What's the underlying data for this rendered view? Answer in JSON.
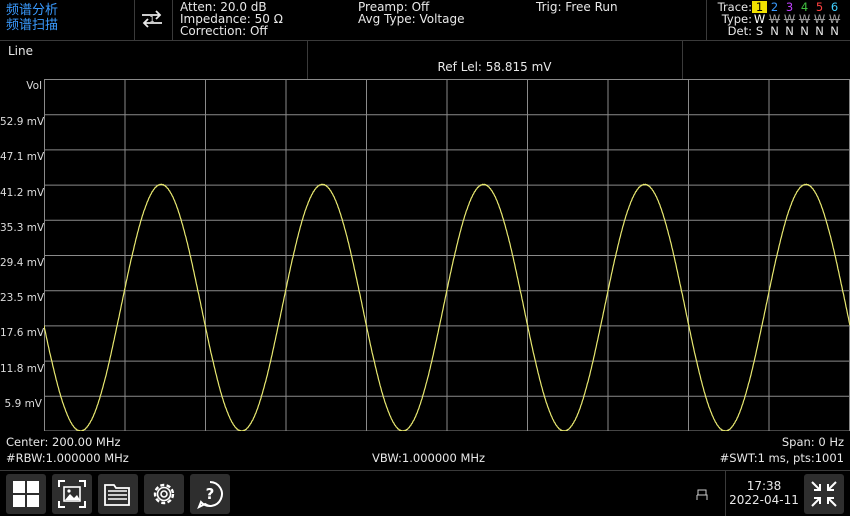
{
  "mode": {
    "line1": "频谱分析",
    "line2": "频谱扫描"
  },
  "status": {
    "atten": "Atten: 20.0 dB",
    "impedance": "Impedance: 50 Ω",
    "correction": "Correction: Off",
    "preamp": "Preamp: Off",
    "avg_type": "Avg Type: Voltage",
    "trig": "Trig: Free Run"
  },
  "trace_panel": {
    "trace_label": "Trace:",
    "type_label": "Type:",
    "det_label": "Det:",
    "numbers": [
      "1",
      "2",
      "3",
      "4",
      "5",
      "6"
    ],
    "number_colors": [
      "#000000",
      "#3a9bff",
      "#c040ff",
      "#40c040",
      "#ff4040",
      "#40d0ff"
    ],
    "types": [
      "W",
      "W",
      "W",
      "W",
      "W",
      "W"
    ],
    "dets": [
      "S",
      "N",
      "N",
      "N",
      "N",
      "N"
    ]
  },
  "header": {
    "title": "Line",
    "ref_level": "Ref Lel: 58.815 mV"
  },
  "y_axis": {
    "unit": "Vol",
    "ticks": [
      "52.9 mV",
      "47.1 mV",
      "41.2 mV",
      "35.3 mV",
      "29.4 mV",
      "23.5 mV",
      "17.6 mV",
      "11.8 mV",
      "5.9 mV"
    ]
  },
  "chart_data": {
    "type": "line",
    "title": "",
    "xlabel": "",
    "ylabel": "Vol",
    "ylim": [
      0,
      58.815
    ],
    "x_span_divisions": 10,
    "series": [
      {
        "color": "#e8e870",
        "shape": "sinusoid",
        "periods_across_screen": 5,
        "max_mV": 41.2,
        "min_mV": 0,
        "start_mV": 17.6
      }
    ],
    "grid": true
  },
  "footer": {
    "center": "Center: 200.00 MHz",
    "span": "Span: 0 Hz",
    "rbw": "#RBW:1.000000 MHz",
    "vbw": "VBW:1.000000 MHz",
    "swt": "#SWT:1 ms, pts:1001"
  },
  "taskbar": {
    "buttons": [
      "apps-icon",
      "screenshot-icon",
      "folder-icon",
      "settings-icon",
      "help-icon"
    ],
    "time": "17:38",
    "date": "2022-04-11",
    "status_icon": "usb-icon"
  },
  "colors": {
    "accent": "#3a9bff",
    "trace": "#e8e870",
    "grid": "#8a8a8a",
    "selected_trace": "#f0e000"
  }
}
